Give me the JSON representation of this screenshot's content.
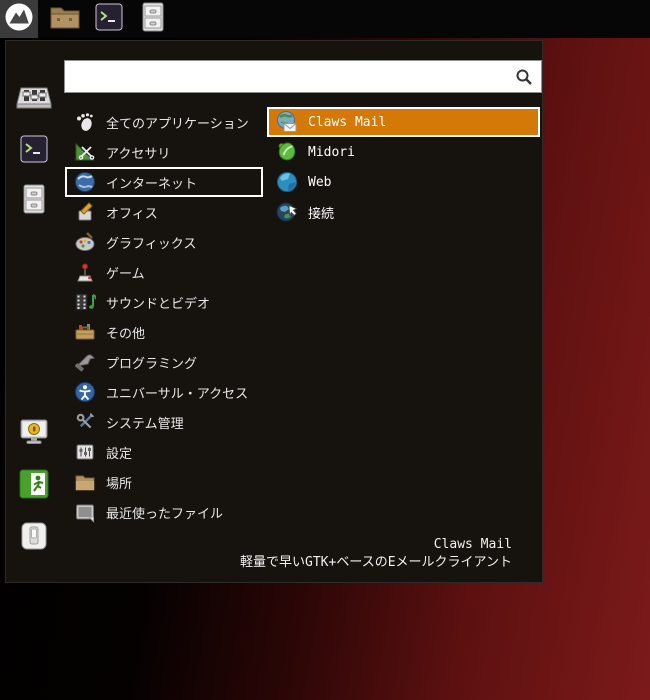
{
  "panel": {
    "menu_button_icon": "distro-logo",
    "launchers": [
      {
        "icon": "file-manager-folder"
      },
      {
        "icon": "terminal"
      },
      {
        "icon": "file-cabinet"
      }
    ]
  },
  "menu": {
    "search": {
      "value": "",
      "placeholder": ""
    },
    "sidebar": {
      "favorites": [
        {
          "icon": "settings-mixer"
        },
        {
          "icon": "terminal"
        },
        {
          "icon": "file-cabinet"
        }
      ],
      "session": [
        {
          "icon": "lock-screen"
        },
        {
          "icon": "log-out"
        },
        {
          "icon": "shut-down"
        }
      ]
    },
    "categories": [
      {
        "label": "全てのアプリケーション",
        "icon": "all-applications",
        "selected": false
      },
      {
        "label": "アクセサリ",
        "icon": "accessories",
        "selected": false
      },
      {
        "label": "インターネット",
        "icon": "internet",
        "selected": true
      },
      {
        "label": "オフィス",
        "icon": "office",
        "selected": false
      },
      {
        "label": "グラフィックス",
        "icon": "graphics",
        "selected": false
      },
      {
        "label": "ゲーム",
        "icon": "games",
        "selected": false
      },
      {
        "label": "サウンドとビデオ",
        "icon": "sound-and-video",
        "selected": false
      },
      {
        "label": "その他",
        "icon": "other",
        "selected": false
      },
      {
        "label": "プログラミング",
        "icon": "programming",
        "selected": false
      },
      {
        "label": "ユニバーサル・アクセス",
        "icon": "universal-access",
        "selected": false
      },
      {
        "label": "システム管理",
        "icon": "system-administration",
        "selected": false
      },
      {
        "label": "設定",
        "icon": "settings",
        "selected": false
      },
      {
        "label": "場所",
        "icon": "places",
        "selected": false
      },
      {
        "label": "最近使ったファイル",
        "icon": "recent-files",
        "selected": false
      }
    ],
    "apps": [
      {
        "label": "Claws Mail",
        "icon": "claws-mail",
        "selected": true
      },
      {
        "label": "Midori",
        "icon": "midori",
        "selected": false
      },
      {
        "label": "Web",
        "icon": "web-browser",
        "selected": false
      },
      {
        "label": "接続",
        "icon": "network-connection",
        "selected": false
      }
    ],
    "selection_info": {
      "title": "Claws Mail",
      "description": "軽量で早いGTK+ベースのEメールクライアント"
    }
  },
  "colors": {
    "accent_orange": "#d47908",
    "selection_border": "#ffffff",
    "menu_background": "#16120e",
    "panel_background": "#060606",
    "desktop_red": "#701616"
  }
}
